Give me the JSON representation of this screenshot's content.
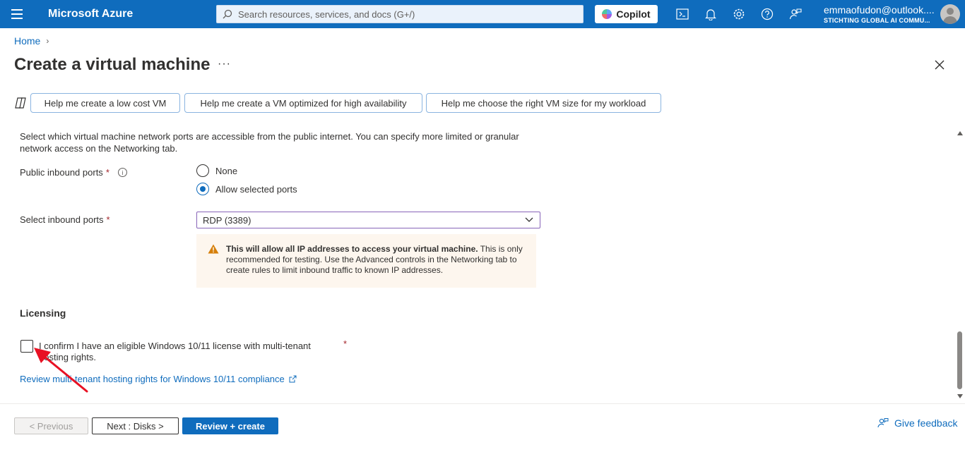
{
  "topbar": {
    "brand": "Microsoft Azure",
    "search_placeholder": "Search resources, services, and docs (G+/)",
    "copilot_label": "Copilot",
    "account_email": "emmaofudon@outlook....",
    "account_org": "STICHTING GLOBAL AI COMMU..."
  },
  "breadcrumb": {
    "home": "Home"
  },
  "page": {
    "title": "Create a virtual machine",
    "more": "···"
  },
  "suggestions": [
    "Help me create a low cost VM",
    "Help me create a VM optimized for high availability",
    "Help me choose the right VM size for my workload"
  ],
  "form": {
    "description": "Select which virtual machine network ports are accessible from the public internet. You can specify more limited or granular network access on the Networking tab.",
    "public_ports_label": "Public inbound ports",
    "required_mark": "*",
    "radio_none": "None",
    "radio_allow": "Allow selected ports",
    "radio_selected": "Allow selected ports",
    "select_ports_label": "Select inbound ports",
    "select_ports_value": "RDP (3389)",
    "warning_bold": "This will allow all IP addresses to access your virtual machine.",
    "warning_text": " This is only recommended for testing.  Use the Advanced controls in the Networking tab to create rules to limit inbound traffic to known IP addresses.",
    "licensing_title": "Licensing",
    "license_checkbox_label": "I confirm I have an eligible Windows 10/11 license with multi-tenant hosting rights.",
    "license_checked": false,
    "review_link": "Review multi-tenant hosting rights for Windows 10/11 compliance"
  },
  "footer": {
    "previous": "< Previous",
    "next": "Next : Disks >",
    "review_create": "Review + create",
    "feedback": "Give feedback"
  },
  "colors": {
    "accent": "#0f6cbd",
    "required": "#a4262c",
    "warning_bg": "#fdf6ee",
    "warning_icon": "#d67f0a",
    "annotation_arrow": "#e81123"
  }
}
